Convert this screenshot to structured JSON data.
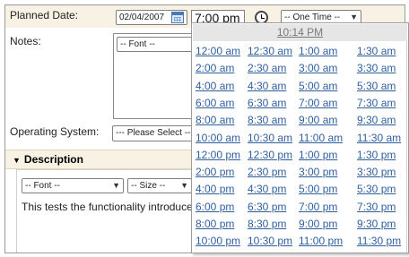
{
  "form": {
    "planned_date_label": "Planned Date:",
    "planned_date_value": "02/04/2007",
    "time_value": "7:00 pm",
    "recurrence_value": "-- One Time --",
    "notes_label": "Notes:",
    "font_select": "-- Font --",
    "operating_system_label": "Operating System:",
    "os_select": "--- Please Select ---"
  },
  "description": {
    "heading": "Description",
    "font_select": "-- Font --",
    "size_select": "-- Size --",
    "body_text": "This tests the functionality introduced"
  },
  "time_picker": {
    "current_time": "10:14 PM",
    "times": [
      [
        "12:00 am",
        "12:30 am",
        "1:00 am",
        "1:30 am"
      ],
      [
        "2:00 am",
        "2:30 am",
        "3:00 am",
        "3:30 am"
      ],
      [
        "4:00 am",
        "4:30 am",
        "5:00 am",
        "5:30 am"
      ],
      [
        "6:00 am",
        "6:30 am",
        "7:00 am",
        "7:30 am"
      ],
      [
        "8:00 am",
        "8:30 am",
        "9:00 am",
        "9:30 am"
      ],
      [
        "10:00 am",
        "10:30 am",
        "11:00 am",
        "11:30 am"
      ],
      [
        "12:00 pm",
        "12:30 pm",
        "1:00 pm",
        "1:30 pm"
      ],
      [
        "2:00 pm",
        "2:30 pm",
        "3:00 pm",
        "3:30 pm"
      ],
      [
        "4:00 pm",
        "4:30 pm",
        "5:00 pm",
        "5:30 pm"
      ],
      [
        "6:00 pm",
        "6:30 pm",
        "7:00 pm",
        "7:30 pm"
      ],
      [
        "8:00 pm",
        "8:30 pm",
        "9:00 pm",
        "9:30 pm"
      ],
      [
        "10:00 pm",
        "10:30 pm",
        "11:00 pm",
        "11:30 pm"
      ]
    ]
  },
  "icons": {
    "calendar": "calendar-icon",
    "clock": "clock-icon",
    "dropdown_arrow": "chevron-down-icon",
    "section_toggle": "triangle-down-icon"
  }
}
